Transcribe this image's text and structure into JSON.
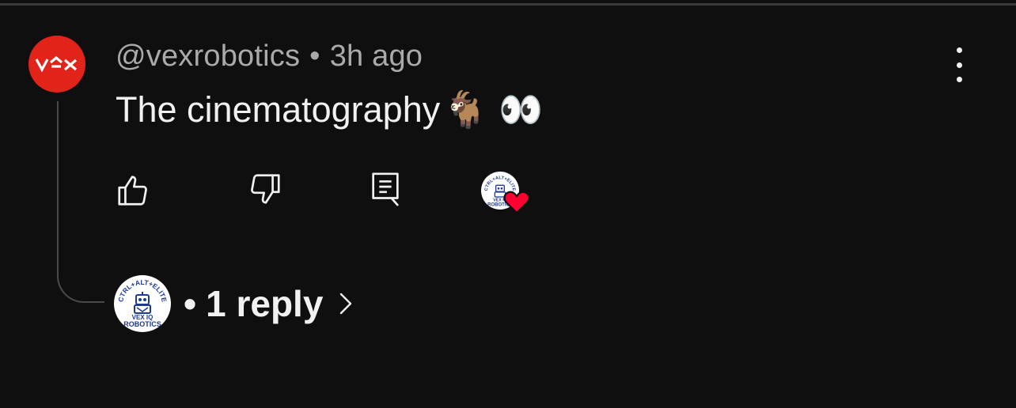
{
  "comment": {
    "author": "@vexrobotics",
    "separator": "•",
    "time": "3h ago",
    "text": "The cinematography",
    "emoji_1": "🐐",
    "emoji_2": "👀"
  },
  "avatar": {
    "logo_text": "VEX",
    "color": "#e2231a"
  },
  "creator_avatar": {
    "top_text": "CTRL+ALT+ELITE",
    "line_1": "VEX IQ",
    "line_2": "ROBOTICS"
  },
  "actions": {
    "like_icon": "thumbs-up-icon",
    "dislike_icon": "thumbs-down-icon",
    "reply_icon": "comment-icon",
    "heart_icon": "heart-icon",
    "heart_color": "#ff0033"
  },
  "replies": {
    "bullet": "•",
    "label": "1 reply"
  },
  "colors": {
    "background": "#0f0f0f",
    "text_primary": "#f1f1f1",
    "text_secondary": "#aaaaaa"
  }
}
